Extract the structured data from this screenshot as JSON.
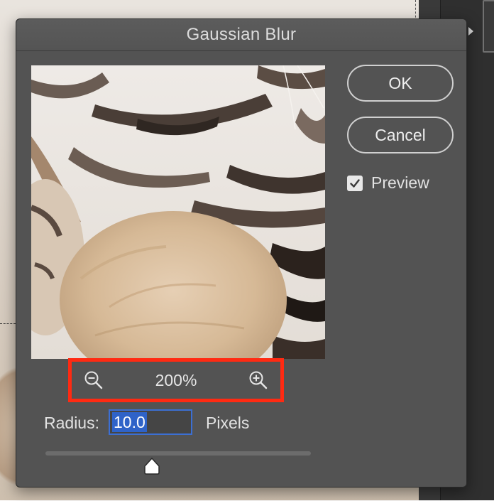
{
  "dialog": {
    "title": "Gaussian Blur",
    "ok_label": "OK",
    "cancel_label": "Cancel",
    "preview_label": "Preview",
    "preview_checked": true
  },
  "zoom": {
    "level": "200%",
    "zoom_out_icon": "zoom-out-icon",
    "zoom_in_icon": "zoom-in-icon"
  },
  "radius": {
    "label": "Radius:",
    "value": "10.0",
    "units": "Pixels",
    "slider_fraction": 0.4
  },
  "colors": {
    "dialog_bg": "#535353",
    "highlight": "#ff2a12",
    "selection": "#2f63c8"
  }
}
